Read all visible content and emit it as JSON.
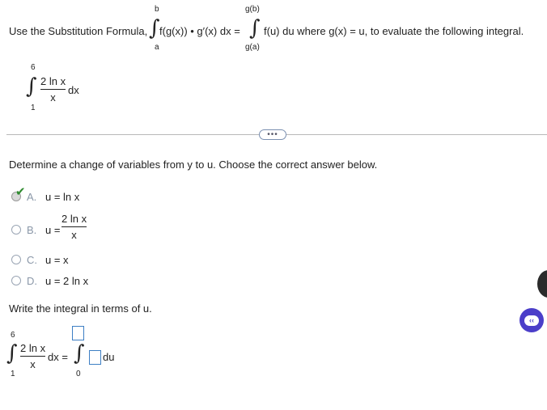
{
  "header": {
    "intro_text": "Use the Substitution Formula,",
    "formula_upper_b": "b",
    "formula_lower_a": "a",
    "formula_left_integrand": "f(g(x)) • g′(x) dx =",
    "formula_upper_gb": "g(b)",
    "formula_lower_ga": "g(a)",
    "formula_right_integrand": "f(u) du where g(x) = u, to evaluate the following integral."
  },
  "given_integral": {
    "upper": "6",
    "lower": "1",
    "numerator": "2 ln x",
    "denominator": "x",
    "differential": "dx"
  },
  "more_button_label": "•••",
  "question1": {
    "prompt": "Determine a change of variables from y to u. Choose the correct answer below.",
    "options": [
      {
        "letter": "A.",
        "text": "u = ln x",
        "selected": true,
        "correct": true
      },
      {
        "letter": "B.",
        "text_prefix": "u =",
        "numerator": "2 ln x",
        "denominator": "x",
        "selected": false
      },
      {
        "letter": "C.",
        "text": "u = x",
        "selected": false
      },
      {
        "letter": "D.",
        "text": "u = 2 ln x",
        "selected": false
      }
    ]
  },
  "question2": {
    "prompt": "Write the integral in terms of u.",
    "left_upper": "6",
    "left_lower": "1",
    "left_numerator": "2 ln x",
    "left_denominator": "x",
    "left_differential": "dx =",
    "right_upper_value": "",
    "right_lower": "0",
    "right_integrand_value": "",
    "right_differential": "du"
  },
  "colors": {
    "check_green": "#2e8b2e",
    "input_border_blue": "#3d7fc4",
    "badge_purple": "#4b3ec9"
  }
}
